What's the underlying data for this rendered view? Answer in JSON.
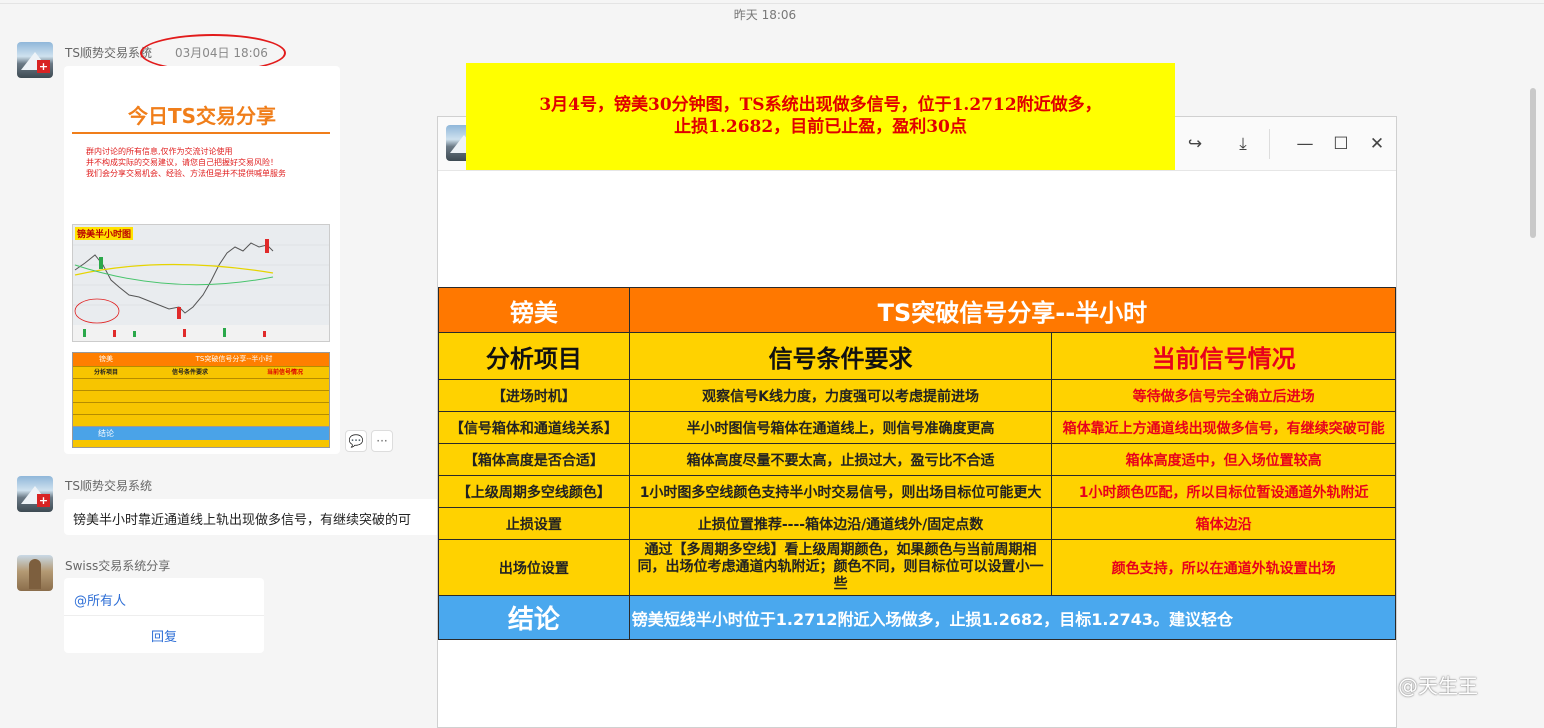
{
  "top_divider_time": "昨天 18:06",
  "messages": [
    {
      "sender": "TS顺势交易系统",
      "time": "03月04日 18:06",
      "card": {
        "title": "今日TS交易分享",
        "disclaimer": [
          "群内讨论的所有信息,仅作为交流讨论使用",
          "并不构成实际的交易建议，请您自己把握好交易风险！",
          "我们会分享交易机会、经验、方法但是并不提供喊单服务"
        ],
        "chart_label": "镑美半小时图"
      }
    },
    {
      "sender": "TS顺势交易系统",
      "text": "镑美半小时靠近通道线上轨出现做多信号，有继续突破的可"
    },
    {
      "sender": "Swiss交易系统分享",
      "mention": "@所有人",
      "reply_label": "回复"
    }
  ],
  "actions": {
    "comment_icon": "comment-icon",
    "more": "···"
  },
  "viewer": {
    "share_icon": "share-icon",
    "download_icon": "download-icon",
    "minimize": "—",
    "maximize": "☐",
    "close": "✕"
  },
  "banner": {
    "line1": "3月4号，镑美30分钟图，TS系统出现做多信号，位于1.2712附近做多，",
    "line2": "止损1.2682，目前已止盈，盈利30点"
  },
  "table": {
    "pair": "镑美",
    "title": "TS突破信号分享--半小时",
    "headers": [
      "分析项目",
      "信号条件要求",
      "当前信号情况"
    ],
    "rows": [
      [
        "【进场时机】",
        "观察信号K线力度，力度强可以考虑提前进场",
        "等待做多信号完全确立后进场"
      ],
      [
        "【信号箱体和通道线关系】",
        "半小时图信号箱体在通道线上，则信号准确度更高",
        "箱体靠近上方通道线出现做多信号，有继续突破可能"
      ],
      [
        "【箱体高度是否合适】",
        "箱体高度尽量不要太高，止损过大，盈亏比不合适",
        "箱体高度适中，但入场位置较高"
      ],
      [
        "【上级周期多空线颜色】",
        "1小时图多空线颜色支持半小时交易信号，则出场目标位可能更大",
        "1小时颜色匹配，所以目标位暂设通道外轨附近"
      ],
      [
        "止损设置",
        "止损位置推荐----箱体边沿/通道线外/固定点数",
        "箱体边沿"
      ],
      [
        "出场位设置",
        "通过【多周期多空线】看上级周期颜色，如果颜色与当前周期相同，出场位考虑通道内轨附近；颜色不同，则目标位可以设置小一些",
        "颜色支持，所以在通道外轨设置出场"
      ]
    ],
    "conclusion_label": "结论",
    "conclusion_text": "镑美短线半小时位于1.2712附近入场做多，止损1.2682，目标1.2743。建议轻仓"
  },
  "watermark": "@天生王",
  "colors": {
    "orange": "#ff7800",
    "gold": "#ffd200",
    "blue": "#4aa8ee",
    "red": "#e8001c",
    "banner_yellow": "#ffff00"
  }
}
